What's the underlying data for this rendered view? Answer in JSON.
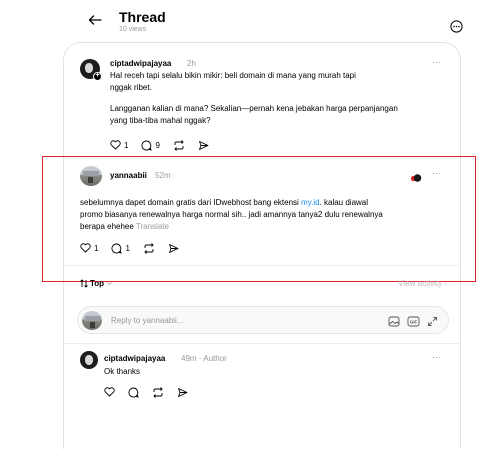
{
  "header": {
    "title": "Thread",
    "views": "10 views"
  },
  "op_post": {
    "username": "ciptadwipajayaa",
    "time": "2h",
    "line1": "Hal receh tapi selalu bikin mikir: beli domain di mana yang murah tapi",
    "line2": "nggak ribet.",
    "line3": "Langganan kalian di mana? Sekalian—pernah kena jebakan harga perpanjangan",
    "line4": "yang tiba-tiba mahal nggak?",
    "likes": "1",
    "replies": "9"
  },
  "reply_post": {
    "username": "yannaabii",
    "time": "52m",
    "line1_pre": "sebelumnya dapet domain gratis dari IDwebhost bang ektensi ",
    "line1_link": "my.id",
    "line1_post": ". kalau diawal",
    "line2": "promo biasanya renewalnya harga normal sih.. jadi amannya tanya2 dulu renewalnya",
    "line3": "berapa ehehee",
    "translate": "Translate",
    "likes": "1",
    "replies": "1"
  },
  "sort": {
    "label": "Top",
    "view_activity": "View activity"
  },
  "reply_input": {
    "placeholder": "Reply to yannaabii..."
  },
  "author_reply": {
    "username": "ciptadwipajayaa",
    "time": "49m",
    "author_tag": "Author",
    "text": "Ok thanks"
  },
  "colors": {
    "link": "#1d8cf0",
    "highlight": "#e0242b",
    "muted": "#999999"
  }
}
